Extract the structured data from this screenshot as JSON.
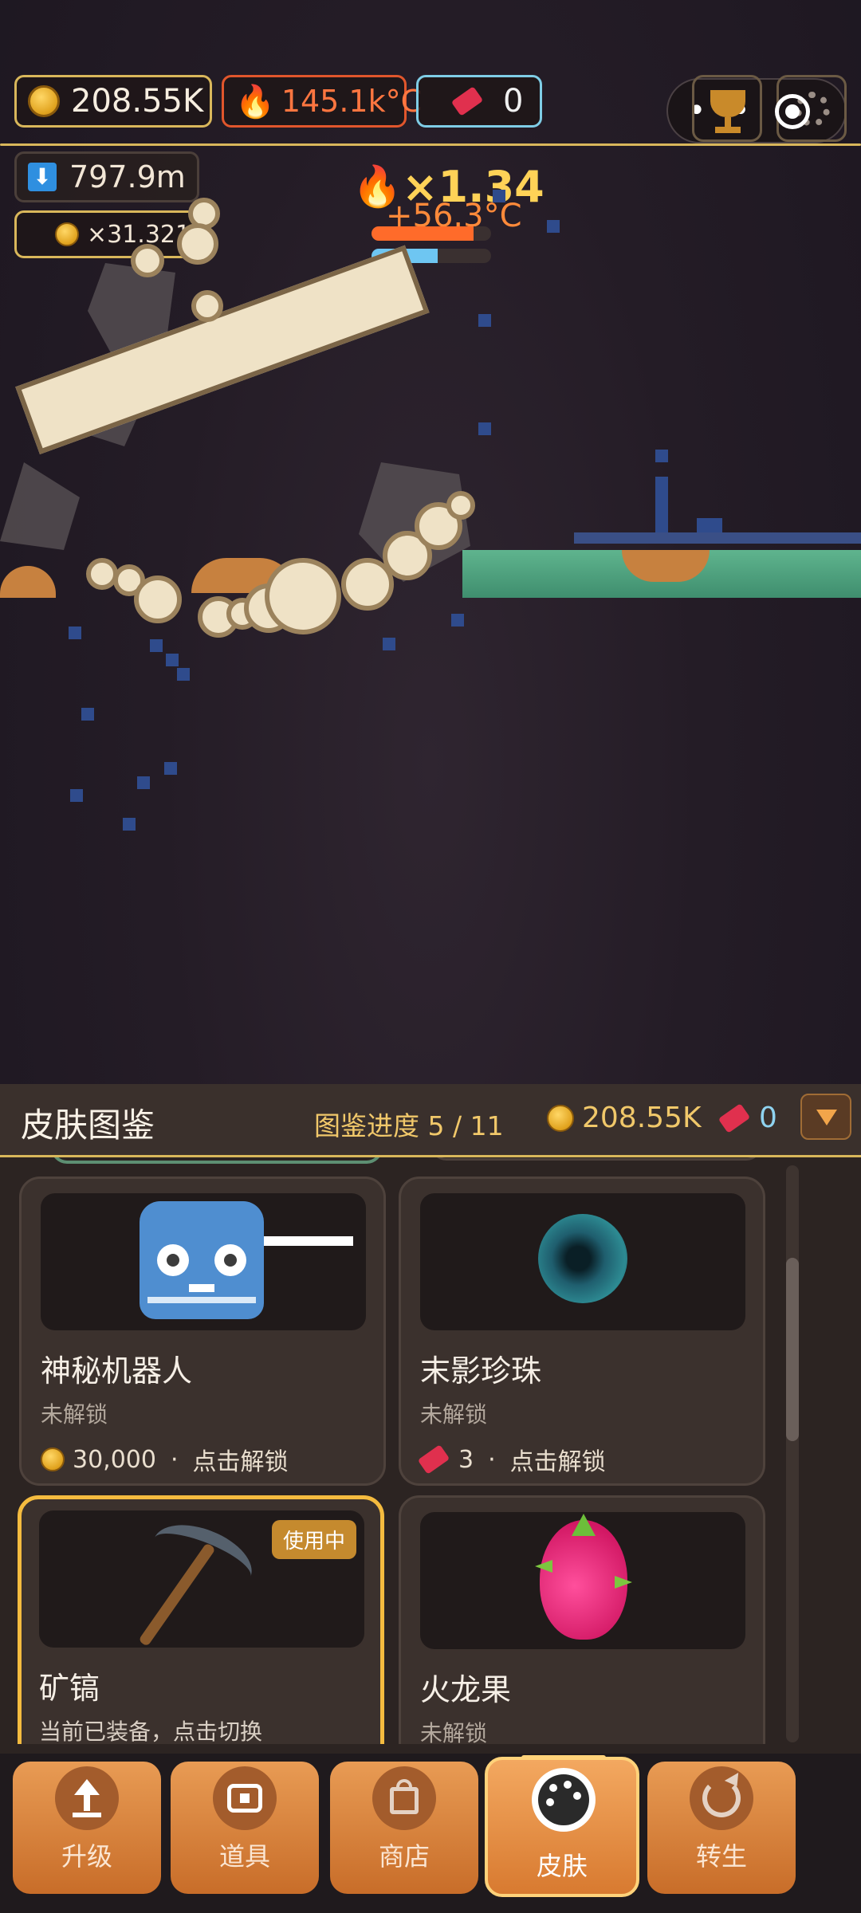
{
  "hud": {
    "coins": "208.55K",
    "heat": "145.1k°C",
    "tickets": "0",
    "depth": "797.9m",
    "coin_multiplier": "×31.321",
    "fire_multiplier": "×1.34",
    "heat_gain": "+56.3°C",
    "heat_bar_level": 0.85,
    "water_bar_level": 0.55,
    "icons": [
      "coin-icon",
      "fire-icon",
      "ticket-icon",
      "download-arrow-icon",
      "trophy-icon",
      "gear-icon",
      "more-icon",
      "record-icon"
    ]
  },
  "panel": {
    "title": "皮肤图鉴",
    "progress": "图鉴进度 5 / 11",
    "coins": "208.55K",
    "tickets": "0",
    "collapse_icon": "triangle-down-icon"
  },
  "cards": [
    {
      "name": "神秘机器人",
      "state": "未解锁",
      "cost": "30,000",
      "currency": "coin",
      "action": "点击解锁",
      "art": "godot-robot"
    },
    {
      "name": "末影珍珠",
      "state": "未解锁",
      "cost": "3",
      "currency": "ticket",
      "action": "点击解锁",
      "art": "ender-pearl"
    },
    {
      "name": "矿镐",
      "state": "当前已装备，点击切换",
      "badge": "使用中",
      "art": "pickaxe"
    },
    {
      "name": "火龙果",
      "state": "未解锁",
      "art": "dragon-fruit"
    }
  ],
  "price_separator": "·",
  "nav": [
    {
      "label": "升级",
      "icon": "upload-icon"
    },
    {
      "label": "道具",
      "icon": "chest-icon"
    },
    {
      "label": "商店",
      "icon": "bag-icon"
    },
    {
      "label": "皮肤",
      "icon": "palette-icon",
      "selected": true
    },
    {
      "label": "转生",
      "icon": "refresh-icon"
    }
  ],
  "colors": {
    "accent_gold": "#d9b75b",
    "heat_red": "#ff6b3a",
    "ticket_blue": "#8fd3f0",
    "nav_orange": "#d87a30"
  }
}
